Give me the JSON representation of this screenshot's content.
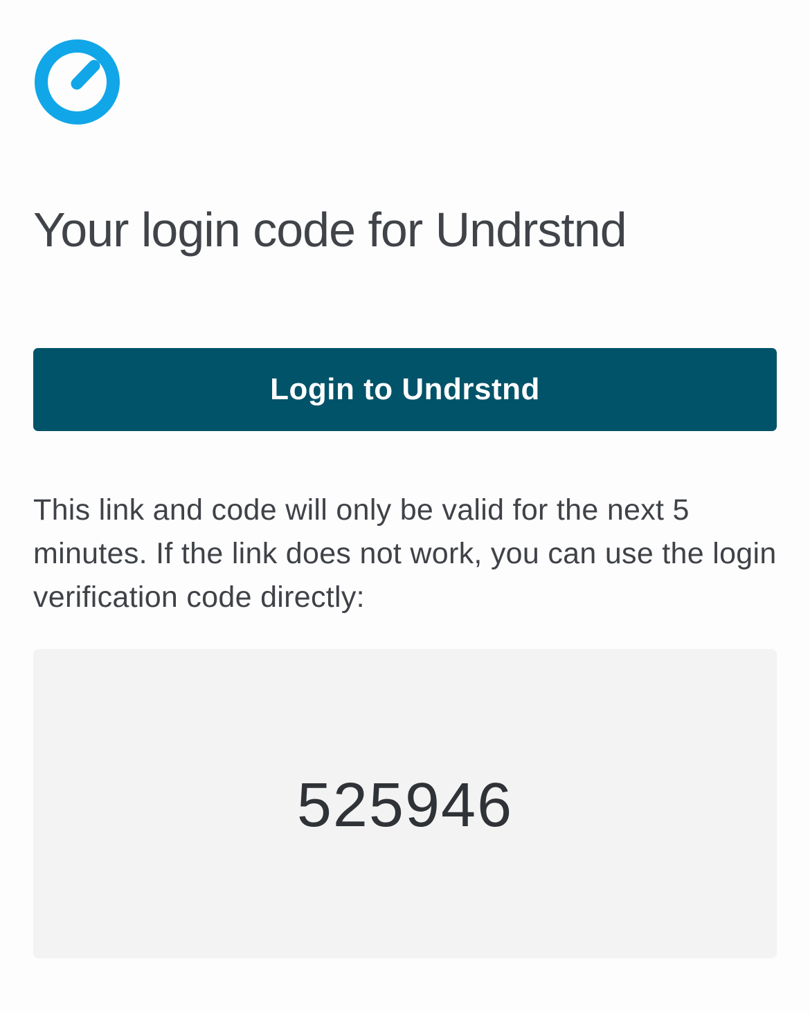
{
  "brand": {
    "logo_icon": "undrstnd-gauge-icon",
    "accent_color": "#11a6e8"
  },
  "email": {
    "title": "Your login code for Undrstnd",
    "login_button_label": "Login to Undrstnd",
    "button_color": "#015369",
    "info_text": "This link and code will only be valid for the next 5 minutes. If the link does not work, you can use the login verification code directly:",
    "verification_code": "525946"
  }
}
